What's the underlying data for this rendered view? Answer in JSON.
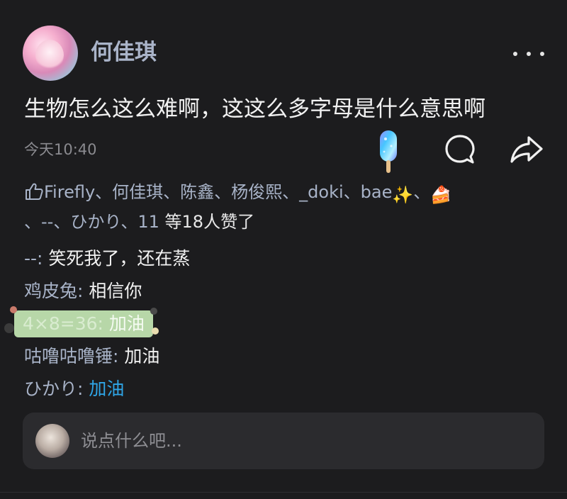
{
  "post": {
    "author": "何佳琪",
    "content": "生物怎么这么难啊，这这么多字母是什么意思啊",
    "time": "今天10:40"
  },
  "actions": {
    "comment_icon": "comment-bubble-icon",
    "share_icon": "share-arrow-icon",
    "more_icon": "more-dots-icon",
    "sticker": "popsicle-icon"
  },
  "likes": {
    "line1_names": "Firefly、何佳琪、陈鑫、杨俊熙、_doki、bae",
    "line1_emoji": "✨",
    "line1_sep": "、",
    "line1_cake": "🍰",
    "line2_names": "、--、ひかり、11",
    "line2_suffix": " 等18人赞了"
  },
  "comments": [
    {
      "name": "--",
      "text": "笑死我了，还在蒸"
    },
    {
      "name": "鸡皮兔",
      "text": "相信你"
    },
    {
      "name": "4×8=36",
      "text": "加油"
    },
    {
      "name": "咕噜咕噜锤",
      "text": "加油"
    },
    {
      "name": "ひかり",
      "text": "加油"
    }
  ],
  "input": {
    "placeholder": "说点什么吧..."
  },
  "colors": {
    "background": "#1c1c1e",
    "name_blue": "#a8b3c8",
    "link_blue": "#2fa6e8",
    "bubble_green": "#b7d7a8"
  }
}
